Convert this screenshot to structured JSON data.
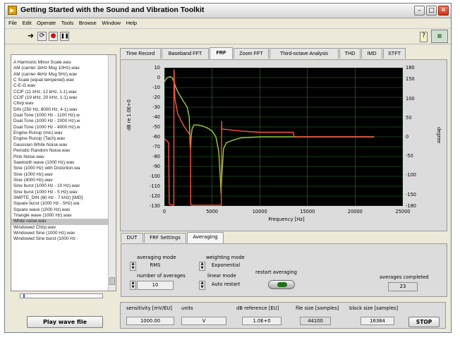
{
  "window": {
    "title": "Getting Started with the Sound and Vibration Toolkit"
  },
  "menu": [
    "File",
    "Edit",
    "Operate",
    "Tools",
    "Browse",
    "Window",
    "Help"
  ],
  "file_list": [
    "A Harmonic Minor Scale.wav",
    "AM (carrier 1kHz Msg 10Hz).wav",
    "AM (carrier 4kHz Msg 5Hz).wav",
    "C Scale (equal tempered).wav",
    "C-E-G.wav",
    "CCIF (11 kHz, 12 kHz, 1-1).wav",
    "CCIF (19 kHz, 20 kHz, 1-1).wav",
    "Chirp.wav",
    "DIN (250 Hz, 8000 Hz, 4-1).wav",
    "Dual Tone (1000 Hz - 1100 Hz).w",
    "Dual Tone (1000 Hz - 2000 Hz).w",
    "Dual Tone (1000 Hz - 4000 Hz).w",
    "Engine Runup (mic).wav",
    "Engine Runup (Tach).wav",
    "Gaussian White Noise.wav",
    "Periodic Random Noise.wav",
    "Pink Noise.wav",
    "Sawtooth wave (1000 Hz).wav",
    "Sine (1000 Hz) with Distortion.wa",
    "Sine (1000 Hz).wav",
    "Sine (4000 Hz).wav",
    "Sine burst (1000 Hz - 10 Hz).wav",
    "Sine burst (1000 Hz - 5 Hz).wav",
    "SMPTE_DIN (60 Hz - 7 kHz) [IMD]",
    "Square burst (1000 Hz - 5Hz).wa",
    "Square wave (1000 Hz).wav",
    "Triangle wave (1000 Hz).wav",
    "White noise.wav",
    "Windowed Chirp.wav",
    "Windowed Sine (1000 Hz).wav",
    "Windowed Sine burst (1000 Hz -"
  ],
  "selected_file": "White noise.wav",
  "buttons": {
    "play": "Play wave file",
    "stop": "STOP",
    "restart": "restart averaging"
  },
  "tabs": [
    "Time Record",
    "Baseband FFT",
    "FRF",
    "Zoom FFT",
    "Third-octave Analysis",
    "THD",
    "IMD",
    "STFT"
  ],
  "active_tab": "FRF",
  "sub_tabs": [
    "DUT",
    "FRF Settings",
    "Averaging"
  ],
  "active_sub_tab": "Averaging",
  "averaging": {
    "averaging_mode_label": "averaging mode",
    "averaging_mode_value": "RMS",
    "weighting_mode_label": "weighting mode",
    "weighting_mode_value": "Exponential",
    "number_of_averages_label": "number of averages",
    "number_of_averages_value": "10",
    "linear_mode_label": "linear mode",
    "linear_mode_value": "Auto restart",
    "restart_label": "restart averaging",
    "averages_completed_label": "averages completed",
    "averages_completed_value": "23"
  },
  "bottom": {
    "sensitivity_label": "sensitivity [mV/EU]",
    "sensitivity_value": "1000.00",
    "units_label": "units",
    "units_value": "V",
    "db_reference_label": "dB reference [EU]",
    "db_reference_value": "1.0E+0",
    "file_size_label": "file size [samples]",
    "file_size_value": "44100",
    "block_size_label": "block size [samples]",
    "block_size_value": "16384"
  },
  "chart_data": {
    "type": "line",
    "xlabel": "Frequency [Hz]",
    "ylabel": "dB re 1.0E+0",
    "y2label": "degree",
    "xlim": [
      0,
      25000
    ],
    "ylim": [
      -130,
      10
    ],
    "y2lim": [
      -180,
      180
    ],
    "xticks": [
      "0",
      "5000",
      "10000",
      "15000",
      "20000",
      "25000"
    ],
    "yticks": [
      "10",
      "0",
      "-10",
      "-20",
      "-30",
      "-40",
      "-50",
      "-60",
      "-70",
      "-80",
      "-90",
      "-100",
      "-110",
      "-120",
      "-130"
    ],
    "y2ticks": [
      "180",
      "150",
      "100",
      "50",
      "0",
      "-50",
      "-100",
      "-150",
      "-180"
    ],
    "grid": true,
    "background": "#000000",
    "colors": {
      "magnitude": "#9ccf3c",
      "phase": "#ff5040",
      "grid": "#2e7a2e"
    },
    "series": [
      {
        "axis": "left",
        "x": [
          0,
          300,
          600,
          800,
          1000,
          1200,
          1500,
          2000,
          2400,
          2600,
          2700,
          2750,
          2800,
          2900,
          3100,
          3500,
          4000,
          4500,
          5000,
          5400,
          5700,
          5850,
          5950,
          6050,
          6200,
          6500,
          7000,
          8000,
          10000,
          12000,
          15000,
          18000,
          20000,
          22000
        ],
        "values": [
          -4,
          0,
          1,
          0,
          -4,
          -10,
          -16,
          -24,
          -30,
          -40,
          -68,
          -72,
          -60,
          -52,
          -48,
          -48,
          -49,
          -51,
          -54,
          -60,
          -75,
          -100,
          -118,
          -95,
          -72,
          -66,
          -64,
          -61,
          -60,
          -60,
          -60,
          -60,
          -60,
          -60
        ]
      },
      {
        "axis": "right",
        "x": [
          0,
          450,
          500,
          900,
          990,
          1000,
          1010,
          1100,
          1400,
          2000,
          2600,
          2700,
          2740,
          2760,
          2800,
          3500,
          5000,
          5900,
          5960,
          6000,
          6020,
          6200,
          8000,
          10000,
          13500,
          13600,
          16000,
          20000,
          22000
        ],
        "values": [
          -5,
          -15,
          -175,
          -178,
          -178,
          175,
          170,
          100,
          60,
          30,
          8,
          0,
          -5,
          -170,
          -178,
          -178,
          -178,
          -178,
          -178,
          40,
          20,
          20,
          15,
          12,
          12,
          0,
          0,
          0,
          0
        ]
      }
    ]
  }
}
